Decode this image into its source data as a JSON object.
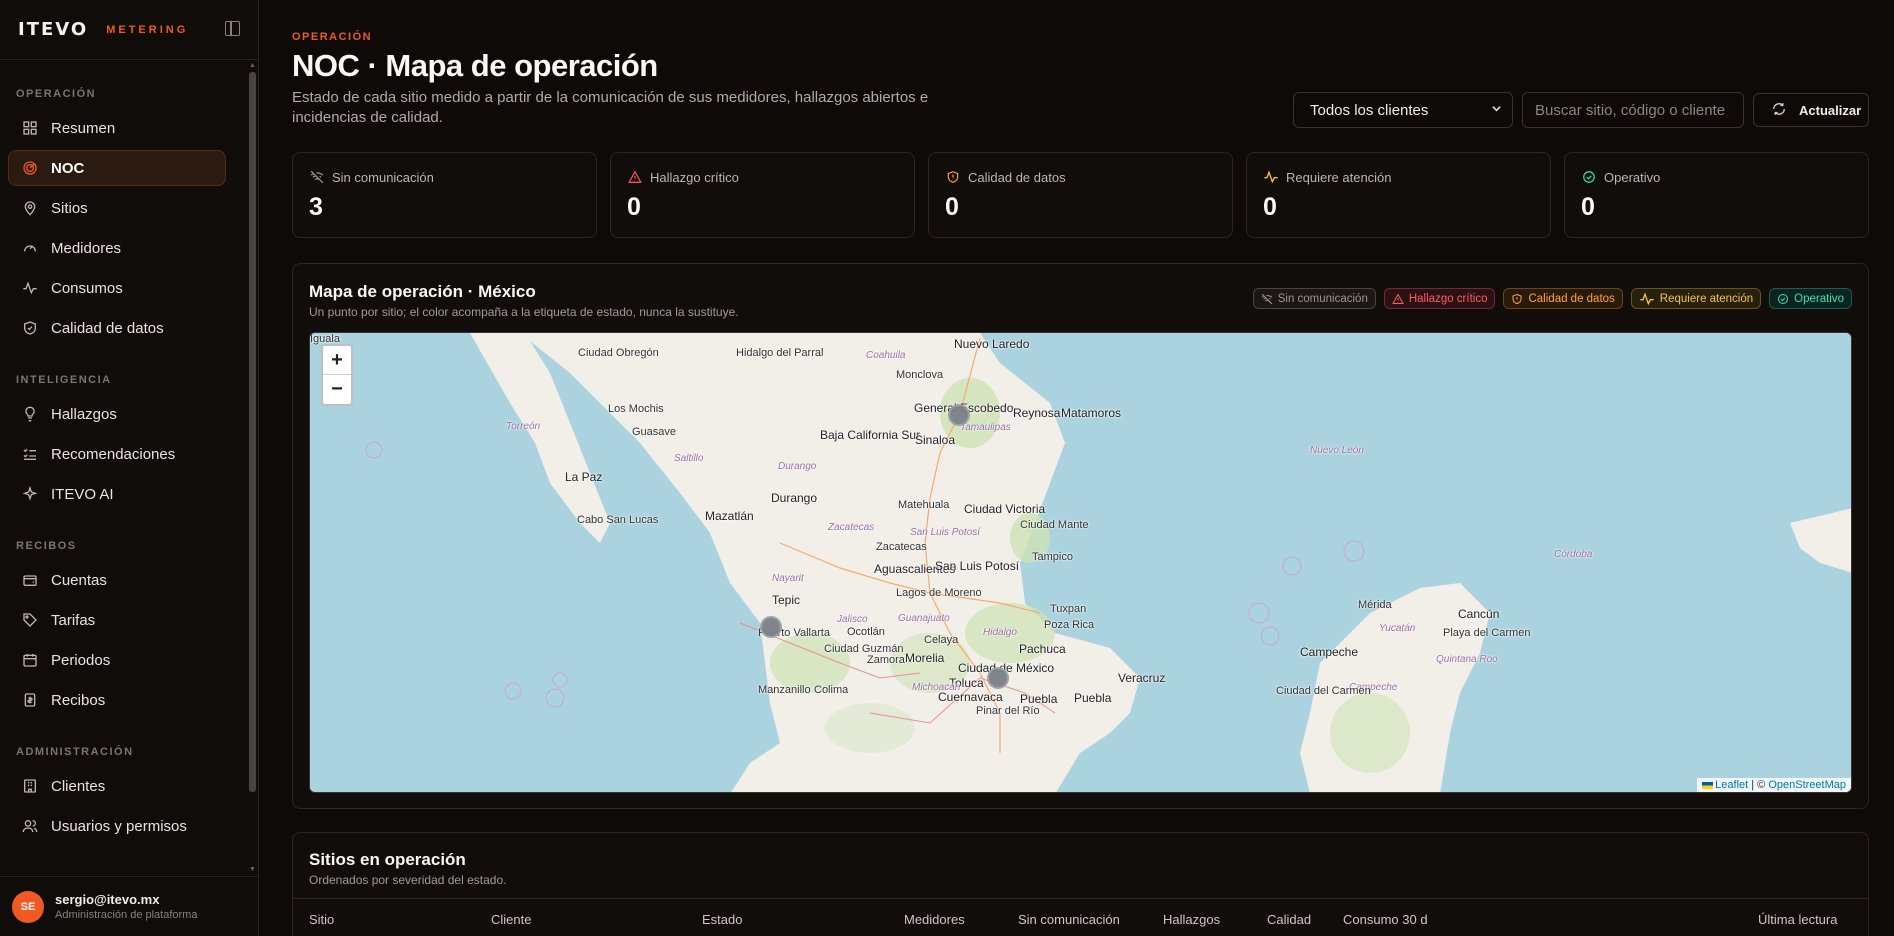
{
  "sidebar": {
    "brand": "ITEVO",
    "brand_tag": "METERING",
    "sections": [
      {
        "title": "OPERACIÓN",
        "items": [
          {
            "label": "Resumen",
            "icon": "grid-icon"
          },
          {
            "label": "NOC",
            "icon": "radar-icon",
            "active": true
          },
          {
            "label": "Sitios",
            "icon": "map-pin-icon"
          },
          {
            "label": "Medidores",
            "icon": "gauge-icon"
          },
          {
            "label": "Consumos",
            "icon": "activity-icon"
          },
          {
            "label": "Calidad de datos",
            "icon": "shield-check-icon"
          }
        ]
      },
      {
        "title": "INTELIGENCIA",
        "items": [
          {
            "label": "Hallazgos",
            "icon": "lightbulb-icon"
          },
          {
            "label": "Recomendaciones",
            "icon": "list-check-icon"
          },
          {
            "label": "ITEVO AI",
            "icon": "sparkles-icon"
          }
        ]
      },
      {
        "title": "RECIBOS",
        "items": [
          {
            "label": "Cuentas",
            "icon": "wallet-icon"
          },
          {
            "label": "Tarifas",
            "icon": "tag-icon"
          },
          {
            "label": "Periodos",
            "icon": "calendar-icon"
          },
          {
            "label": "Recibos",
            "icon": "receipt-icon"
          }
        ]
      },
      {
        "title": "ADMINISTRACIÓN",
        "items": [
          {
            "label": "Clientes",
            "icon": "building-icon"
          },
          {
            "label": "Usuarios y permisos",
            "icon": "users-icon"
          }
        ]
      }
    ],
    "user": {
      "initials": "SE",
      "email": "sergio@itevo.mx",
      "role": "Administración de plataforma"
    }
  },
  "header": {
    "eyebrow": "OPERACIÓN",
    "title": "NOC · Mapa de operación",
    "description": "Estado de cada sitio medido a partir de la comunicación de sus medidores, hallazgos abiertos e incidencias de calidad.",
    "client_select": "Todos los clientes",
    "search_placeholder": "Buscar sitio, código o cliente",
    "refresh_label": "Actualizar"
  },
  "kpis": [
    {
      "label": "Sin comunicación",
      "value": "3",
      "icon": "wifi-off-icon",
      "color": "#9d9590"
    },
    {
      "label": "Hallazgo crítico",
      "value": "0",
      "icon": "alert-triangle-icon",
      "color": "#ff5a66"
    },
    {
      "label": "Calidad de datos",
      "value": "0",
      "icon": "shield-alert-icon",
      "color": "#ffa43a"
    },
    {
      "label": "Requiere atención",
      "value": "0",
      "icon": "activity-icon",
      "color": "#f6c343"
    },
    {
      "label": "Operativo",
      "value": "0",
      "icon": "check-circle-icon",
      "color": "#2ee6b5"
    }
  ],
  "map_card": {
    "title": "Mapa de operación · México",
    "subtitle": "Un punto por sitio; el color acompaña a la etiqueta de estado, nunca la sustituye.",
    "legend": [
      "Sin comunicación",
      "Hallazgo crítico",
      "Calidad de datos",
      "Requiere atención",
      "Operativo"
    ],
    "zoom_in": "+",
    "zoom_out": "−",
    "attribution_leaflet": "Leaflet",
    "attribution_sep": " | © ",
    "attribution_osm": "OpenStreetMap",
    "places": [
      "Nuevo Laredo",
      "Ciudad Obregón",
      "Hidalgo del Parral",
      "Coahuila",
      "Monclova",
      "General Escobedo",
      "Reynosa",
      "Matamoros",
      "Los Mochis",
      "Guasave",
      "Torreón",
      "Saltillo",
      "Nuevo León",
      "Baja California Sur",
      "Sinaloa",
      "Tamaulipas",
      "La Paz",
      "Durango",
      "Durango",
      "Matehuala",
      "Ciudad Victoria",
      "Cabo San Lucas",
      "Mazatlán",
      "Zacatecas",
      "San Luis Potosí",
      "Ciudad Mante",
      "Zacatecas",
      "Tampico",
      "Aguascalientes",
      "San Luis Potosí",
      "Nayarit",
      "Lagos de Moreno",
      "Tepic",
      "Jalisco",
      "Guanajuato",
      "Tuxpan",
      "Mérida",
      "Cancún",
      "Puerto Vallarta",
      "Ocotlán",
      "Celaya",
      "Hidalgo",
      "Poza Rica",
      "Yucatán",
      "Playa del Carmen",
      "Campeche",
      "Ciudad Guzmán",
      "Zamora",
      "Morelia",
      "Pachuca",
      "Quintana Roo",
      "Veracruz",
      "Ciudad de México",
      "Toluca",
      "Michoacán",
      "Puebla",
      "Campeche",
      "Ciudad del Carmen",
      "Manzanillo",
      "Colima",
      "Cuernavaca",
      "Puebla",
      "Córdoba",
      "Pinar del Río",
      "Iguala"
    ]
  },
  "table_card": {
    "title": "Sitios en operación",
    "subtitle": "Ordenados por severidad del estado.",
    "columns": [
      "Sitio",
      "Cliente",
      "Estado",
      "Medidores",
      "Sin comunicación",
      "Hallazgos",
      "Calidad",
      "Consumo 30 d",
      "Última lectura"
    ]
  }
}
